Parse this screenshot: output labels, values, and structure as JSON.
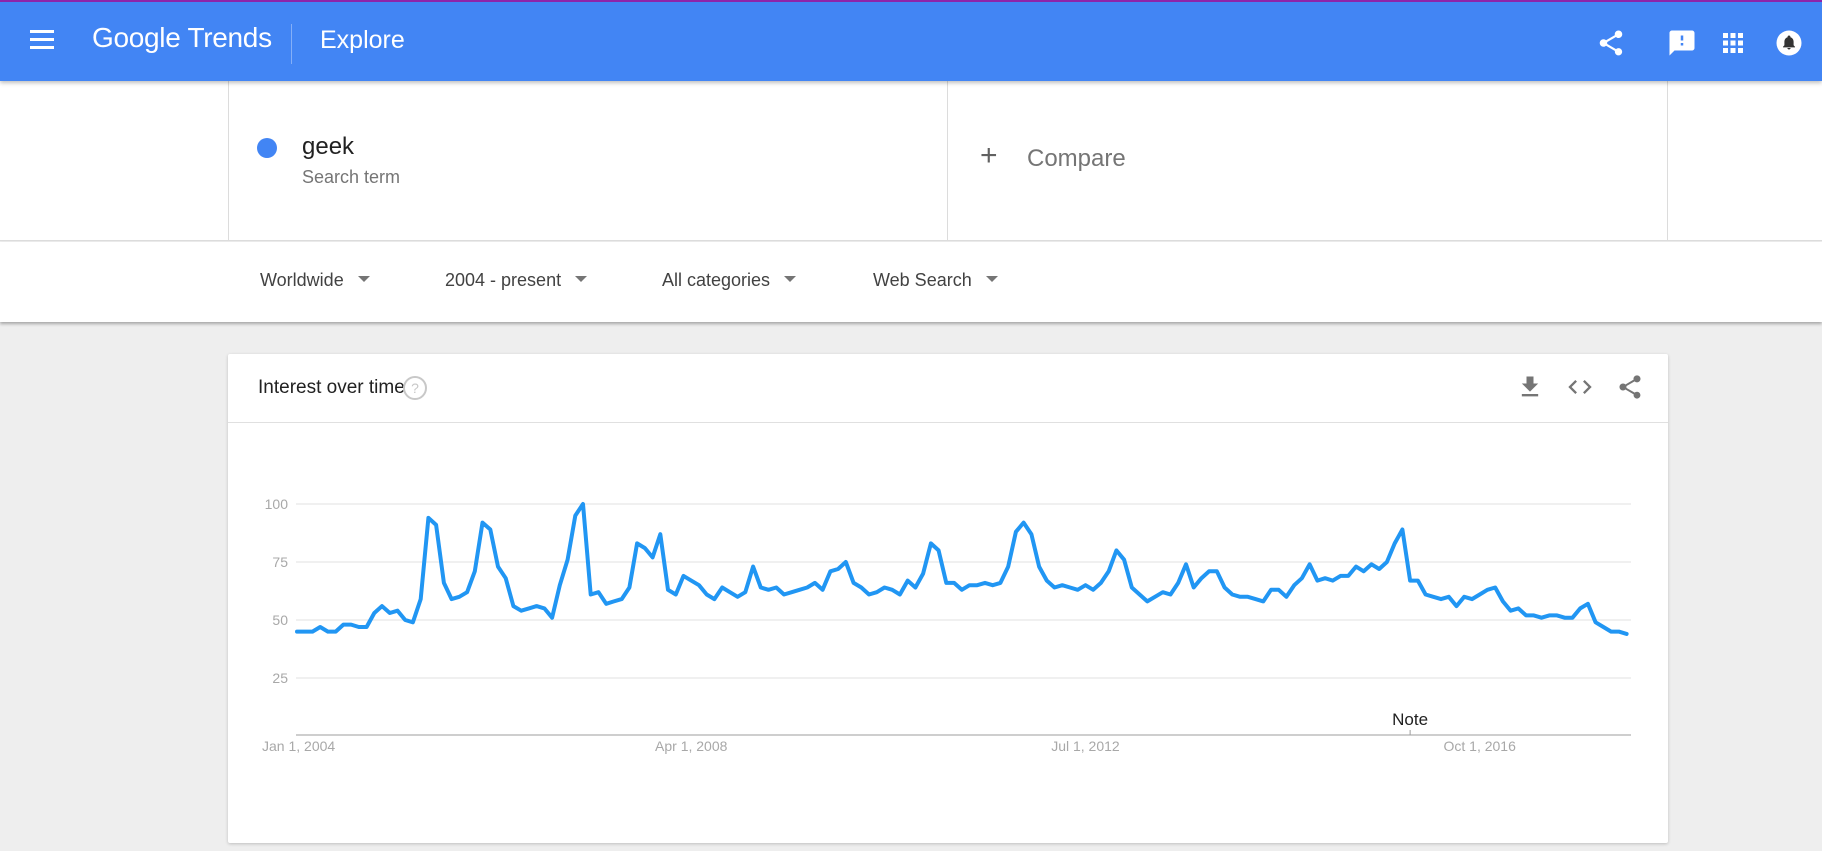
{
  "header": {
    "brand": "Google Trends",
    "page": "Explore",
    "icons": [
      "menu-icon",
      "share-icon",
      "feedback-icon",
      "apps-icon",
      "notifications-icon"
    ],
    "accent_color": "#4285f4"
  },
  "search": {
    "term": "geek",
    "term_type": "Search term",
    "term_color": "#4285f4",
    "compare_label": "Compare"
  },
  "filters": [
    {
      "label": "Worldwide"
    },
    {
      "label": "2004 - present"
    },
    {
      "label": "All categories"
    },
    {
      "label": "Web Search"
    }
  ],
  "card": {
    "title": "Interest over time",
    "icons": [
      "help-icon",
      "download-icon",
      "embed-code-icon",
      "share-icon"
    ]
  },
  "chart_data": {
    "type": "line",
    "title": "Interest over time",
    "xlabel": "",
    "ylabel": "",
    "ylim": [
      0,
      100
    ],
    "yticks": [
      25,
      50,
      75,
      100
    ],
    "grid": true,
    "x_start": "Jan 2004",
    "x_interval": "monthly",
    "xticks": [
      {
        "label": "Jan 1, 2004",
        "index": 0
      },
      {
        "label": "Apr 1, 2008",
        "index": 51
      },
      {
        "label": "Jul 1, 2012",
        "index": 102
      },
      {
        "label": "Oct 1, 2016",
        "index": 153
      }
    ],
    "annotations": [
      {
        "label": "Note",
        "index": 144
      }
    ],
    "series": [
      {
        "name": "geek",
        "color": "#2196f3",
        "values": [
          45,
          45,
          45,
          47,
          45,
          45,
          48,
          48,
          47,
          47,
          53,
          56,
          53,
          54,
          50,
          49,
          59,
          94,
          91,
          66,
          59,
          60,
          62,
          71,
          92,
          89,
          73,
          68,
          56,
          54,
          55,
          56,
          55,
          51,
          65,
          76,
          95,
          100,
          61,
          62,
          57,
          58,
          59,
          64,
          83,
          81,
          77,
          87,
          63,
          61,
          69,
          67,
          65,
          61,
          59,
          64,
          62,
          60,
          62,
          73,
          64,
          63,
          64,
          61,
          62,
          63,
          64,
          66,
          63,
          71,
          72,
          75,
          66,
          64,
          61,
          62,
          64,
          63,
          61,
          67,
          64,
          70,
          83,
          80,
          66,
          66,
          63,
          65,
          65,
          66,
          65,
          66,
          73,
          88,
          92,
          87,
          73,
          67,
          64,
          65,
          64,
          63,
          65,
          63,
          66,
          71,
          80,
          76,
          64,
          61,
          58,
          60,
          62,
          61,
          66,
          74,
          64,
          68,
          71,
          71,
          64,
          61,
          60,
          60,
          59,
          58,
          63,
          63,
          60,
          65,
          68,
          74,
          67,
          68,
          67,
          69,
          69,
          73,
          71,
          74,
          72,
          75,
          83,
          89,
          67,
          67,
          61,
          60,
          59,
          60,
          56,
          60,
          59,
          61,
          63,
          64,
          58,
          54,
          55,
          52,
          52,
          51,
          52,
          52,
          51,
          51,
          55,
          57,
          49,
          47,
          45,
          45,
          44
        ]
      }
    ]
  }
}
